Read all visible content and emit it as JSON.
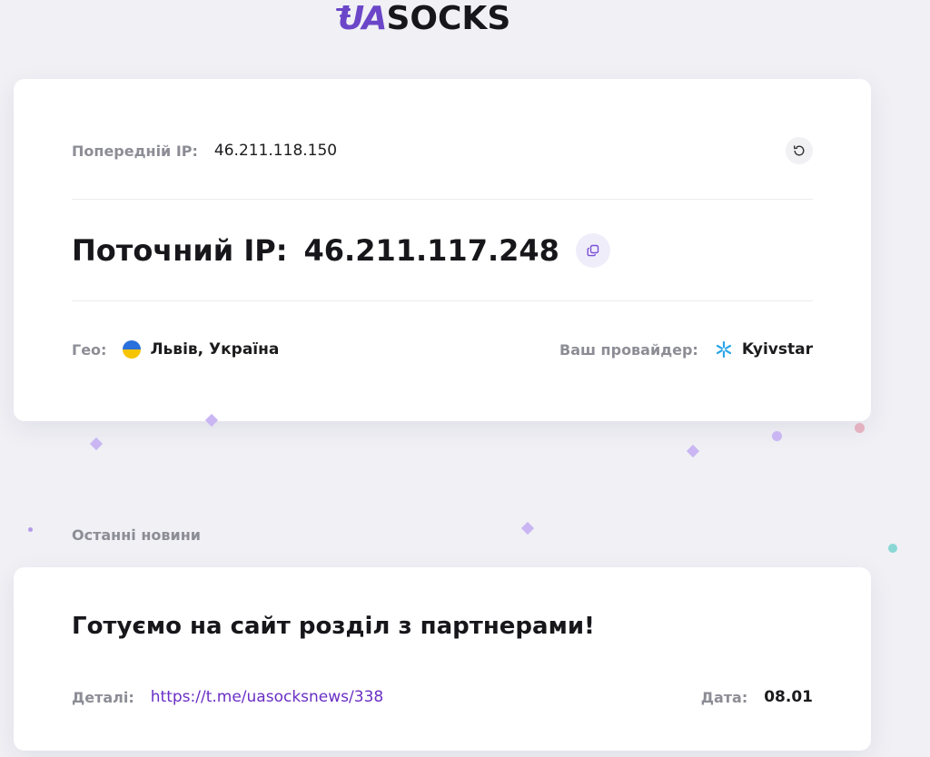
{
  "logo": {
    "mark": "UA",
    "rest": "SOCKS"
  },
  "ip_card": {
    "previous_label": "Попередній IP:",
    "previous_value": "46.211.118.150",
    "current_label": "Поточний IP:",
    "current_value": "46.211.117.248",
    "geo_label": "Гео:",
    "geo_value": "Львів, Україна",
    "provider_label": "Ваш провайдер:",
    "provider_value": "Kyivstar"
  },
  "news": {
    "heading": "Останні новини",
    "title": "Готуємо на сайт розділ з партнерами!",
    "details_label": "Деталі:",
    "details_link": "https://t.me/uasocksnews/338",
    "date_label": "Дата:",
    "date_value": "08.01"
  },
  "colors": {
    "accent": "#6b46c8",
    "link": "#6a2fc4",
    "muted": "#8d8d96",
    "background": "#f0f0f5"
  },
  "icons": {
    "refresh": "refresh-icon",
    "copy": "copy-icon",
    "flag": "ukraine-flag-icon",
    "provider": "kyivstar-star-icon"
  }
}
